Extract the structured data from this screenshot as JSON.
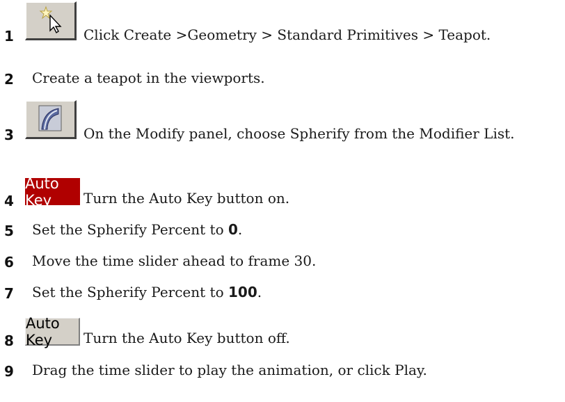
{
  "steps": [
    {
      "num": "1",
      "icon": "create-geometry-icon",
      "text": "Click Create >Geometry > Standard Primitives > Teapot."
    },
    {
      "num": "2",
      "text": "Create a teapot in the viewports."
    },
    {
      "num": "3",
      "icon": "modify-panel-icon",
      "text": "On the Modify panel, choose Spherify from the Modifier List."
    },
    {
      "num": "4",
      "icon_label": "Auto Key",
      "text": "Turn the Auto Key button on."
    },
    {
      "num": "5",
      "text_pre": "Set the Spherify Percent to ",
      "text_bold": "0",
      "text_post": "."
    },
    {
      "num": "6",
      "text": "Move the time slider ahead to frame 30."
    },
    {
      "num": "7",
      "text_pre": "Set the Spherify Percent to ",
      "text_bold": "100",
      "text_post": "."
    },
    {
      "num": "8",
      "icon_label": "Auto Key",
      "text": "Turn the Auto Key button off."
    },
    {
      "num": "9",
      "text": "Drag the time slider to play the animation, or click Play."
    }
  ],
  "colors": {
    "autokey_on": "#b00000",
    "button_face": "#d4d0c8"
  }
}
